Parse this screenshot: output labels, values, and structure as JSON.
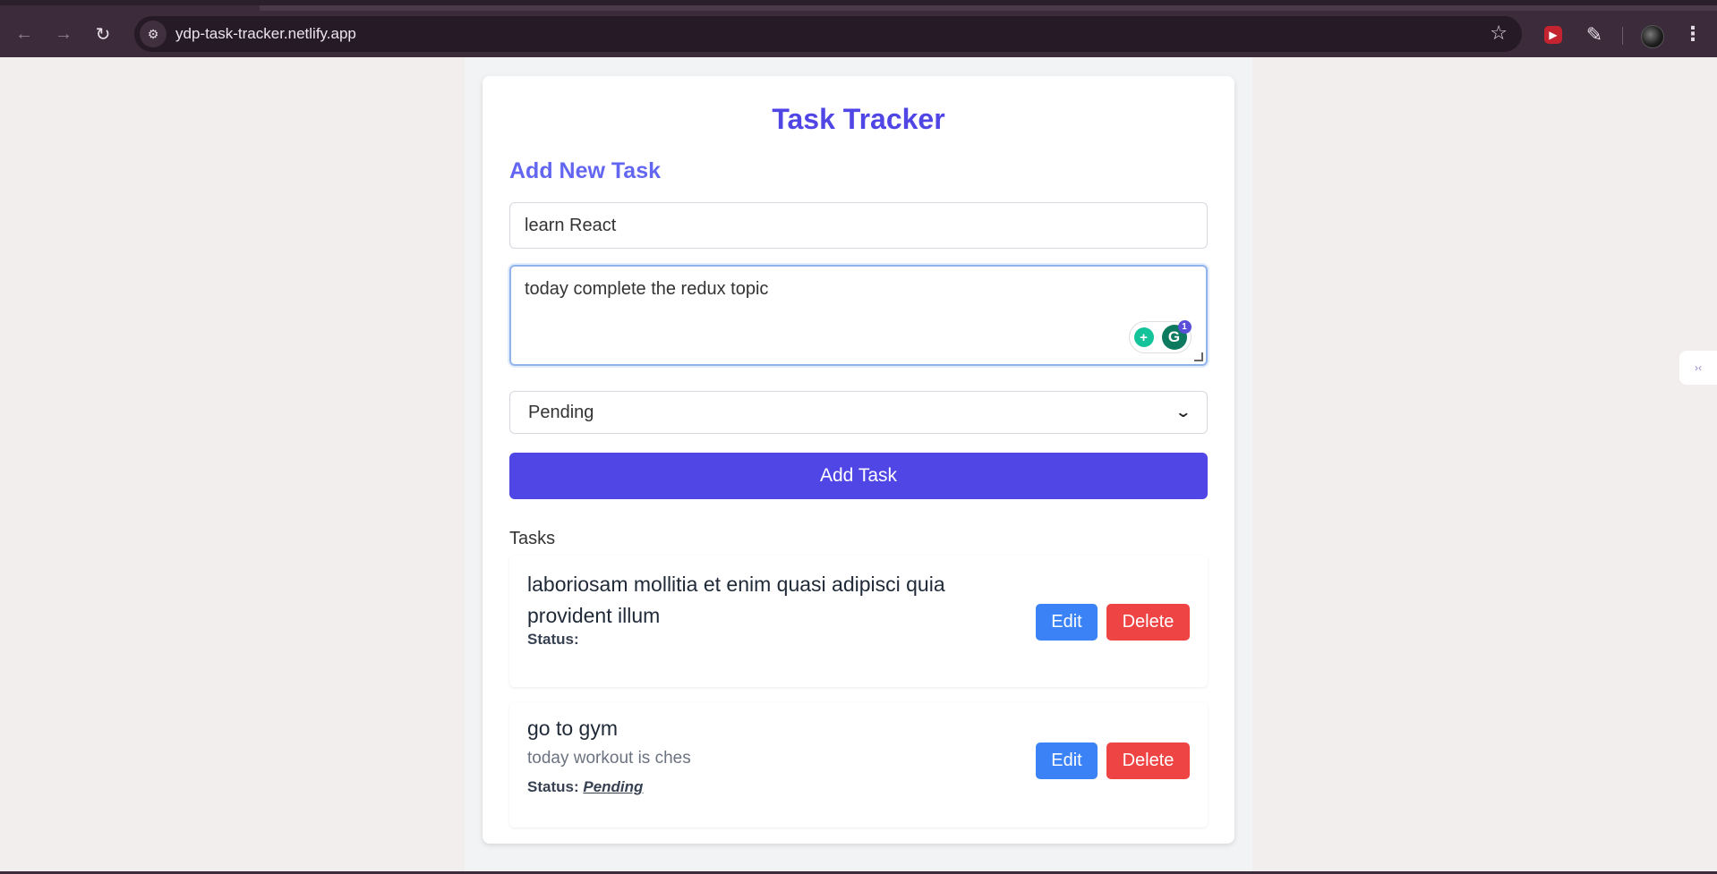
{
  "browser": {
    "url": "ydp-task-tracker.netlify.app",
    "icons": {
      "back": "arrow-left-icon",
      "forward": "arrow-right-icon",
      "reload": "reload-icon",
      "site_info": "tune-icon",
      "bookmark": "star-icon",
      "extension": "red-extension-icon",
      "extensions": "puzzle-icon",
      "profile": "avatar",
      "menu": "kebab-icon"
    }
  },
  "app": {
    "title": "Task Tracker",
    "form": {
      "heading": "Add New Task",
      "title_value": "learn React",
      "description_value": "today complete the redux topic",
      "status_selected": "Pending",
      "submit_label": "Add Task"
    },
    "grammarly": {
      "badge_count": "1",
      "g_letter": "G"
    },
    "tasks_heading": "Tasks",
    "tasks": [
      {
        "title": "laboriosam mollitia et enim quasi adipisci quia provident illum",
        "description": "",
        "status_label": "Status:",
        "status_value": "",
        "edit_label": "Edit",
        "delete_label": "Delete"
      },
      {
        "title": "go to gym",
        "description": "today workout is ches",
        "status_label": "Status:",
        "status_value": "Pending",
        "edit_label": "Edit",
        "delete_label": "Delete"
      }
    ]
  },
  "colors": {
    "primary": "#4f46e5",
    "heading_accent": "#6366f1",
    "edit": "#3b82f6",
    "delete": "#ef4444",
    "browser_chrome": "#3b2b3b"
  }
}
